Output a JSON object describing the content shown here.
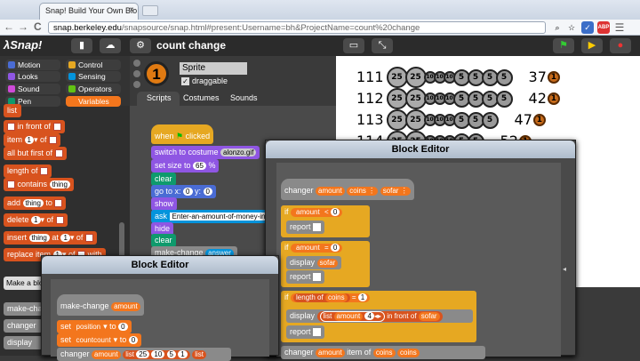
{
  "browser": {
    "tab_title": "Snap! Build Your Own Blo",
    "tab_close": "×",
    "url_host": "snap.berkeley.edu",
    "url_path": "/snapsource/snap.html#present:Username=bh&ProjectName=count%20change",
    "nav_back": "←",
    "nav_forward": "→",
    "nav_reload": "C",
    "ext_icons": [
      "⌕",
      "☆",
      "✓",
      "ABP",
      "☰"
    ]
  },
  "snap": {
    "logo": "λSnap!",
    "file_icon": "▮",
    "cloud_icon": "☁",
    "settings_icon": "⚙",
    "project_name": "count change",
    "stage_size_icon": "▭",
    "fullscreen_icon": "⤡",
    "green_flag": "⚑",
    "pause": "▶",
    "stop": "●"
  },
  "categories": [
    {
      "label": "Motion",
      "color": "#4a6cd4"
    },
    {
      "label": "Control",
      "color": "#e6a822"
    },
    {
      "label": "Looks",
      "color": "#8f56e3"
    },
    {
      "label": "Sensing",
      "color": "#0494dc"
    },
    {
      "label": "Sound",
      "color": "#cf4ad9"
    },
    {
      "label": "Operators",
      "color": "#62c213"
    },
    {
      "label": "Pen",
      "color": "#0e9a6c"
    },
    {
      "label": "Variables",
      "color": "#f3761d"
    }
  ],
  "palette_blocks": {
    "list": "list",
    "in_front_of": "in front of",
    "item": "item",
    "item_num": "1",
    "of": "of",
    "all_but_first_of": "all but first of",
    "length_of": "length of",
    "contains": "contains",
    "contains_arg": "thing",
    "add": "add",
    "add_arg": "thing",
    "to": "to",
    "delete": "delete",
    "delete_num": "1",
    "insert": "insert",
    "insert_arg": "thing",
    "at": "at",
    "insert_num": "1",
    "replace_item": "replace item",
    "replace_num": "1",
    "with": "with",
    "make_a_block": "Make a blo",
    "custom1": "make-chan",
    "custom2": "changer",
    "custom3": "display"
  },
  "sprite": {
    "costume_number": "1",
    "name": "Sprite",
    "draggable_label": "draggable",
    "draggable_checked": true,
    "tabs": [
      "Scripts",
      "Costumes",
      "Sounds"
    ]
  },
  "script": {
    "when": "when",
    "clicked": "clicked",
    "switch_to_costume": "switch to costume",
    "costume_arg": "alonzo.gif",
    "set_size_to": "set size to",
    "size_val": "65",
    "pct": "%",
    "clear": "clear",
    "go_to_x": "go to x:",
    "x_val": "0",
    "y_label": "y:",
    "y_val": "0",
    "show": "show",
    "ask": "ask",
    "ask_arg": "Enter-an-amount-of-money-in-ce",
    "hide": "hide",
    "clear2": "clear",
    "make_change": "make-change",
    "answer": "answer"
  },
  "stage_rows": [
    {
      "label": "111",
      "coins": [
        "25",
        "25",
        "10",
        "10",
        "10",
        "5",
        "5",
        "5",
        "5"
      ],
      "count": "37",
      "ones": "1"
    },
    {
      "label": "112",
      "coins": [
        "25",
        "25",
        "10",
        "10",
        "10",
        "5",
        "5",
        "5",
        "5"
      ],
      "count": "42",
      "ones": "1"
    },
    {
      "label": "113",
      "coins": [
        "25",
        "25",
        "10",
        "10",
        "10",
        "5",
        "5",
        "5"
      ],
      "count": "47",
      "ones": "1"
    },
    {
      "label": "114",
      "coins": [
        "25",
        "25",
        "10",
        "10",
        "10",
        "5",
        "5"
      ],
      "count": "52",
      "ones": "1"
    }
  ],
  "editor_right": {
    "title": "Block Editor",
    "hat": "changer",
    "p1": "amount",
    "p2": "coins",
    "p2_suffix": "⋮",
    "p3": "sofar",
    "p3_suffix": "⋮",
    "if": "if",
    "lt": "<",
    "zero": "0",
    "report": "report",
    "eq": "=",
    "zero2": "0",
    "display": "display",
    "sofar": "sofar",
    "length_of": "length of",
    "coins": "coins",
    "one": "1",
    "list": "list",
    "amount": "amount",
    "four": "4",
    "in_front_of": "in front of",
    "sofar2": "sofar",
    "changer": "changer",
    "amount2": "amount",
    "item": "item",
    "of": "of",
    "coins2": "coins",
    "coins3": "coins"
  },
  "editor_left": {
    "title": "Block Editor",
    "hat": "make-change",
    "p1": "amount",
    "set": "set",
    "var1": "position",
    "to": "to",
    "val1": "0",
    "var2": "countcount",
    "val2": "0",
    "changer": "changer",
    "amount": "amount",
    "list": "list",
    "n1": "25",
    "n2": "10",
    "n3": "5",
    "n4": "1",
    "list2": "list"
  }
}
